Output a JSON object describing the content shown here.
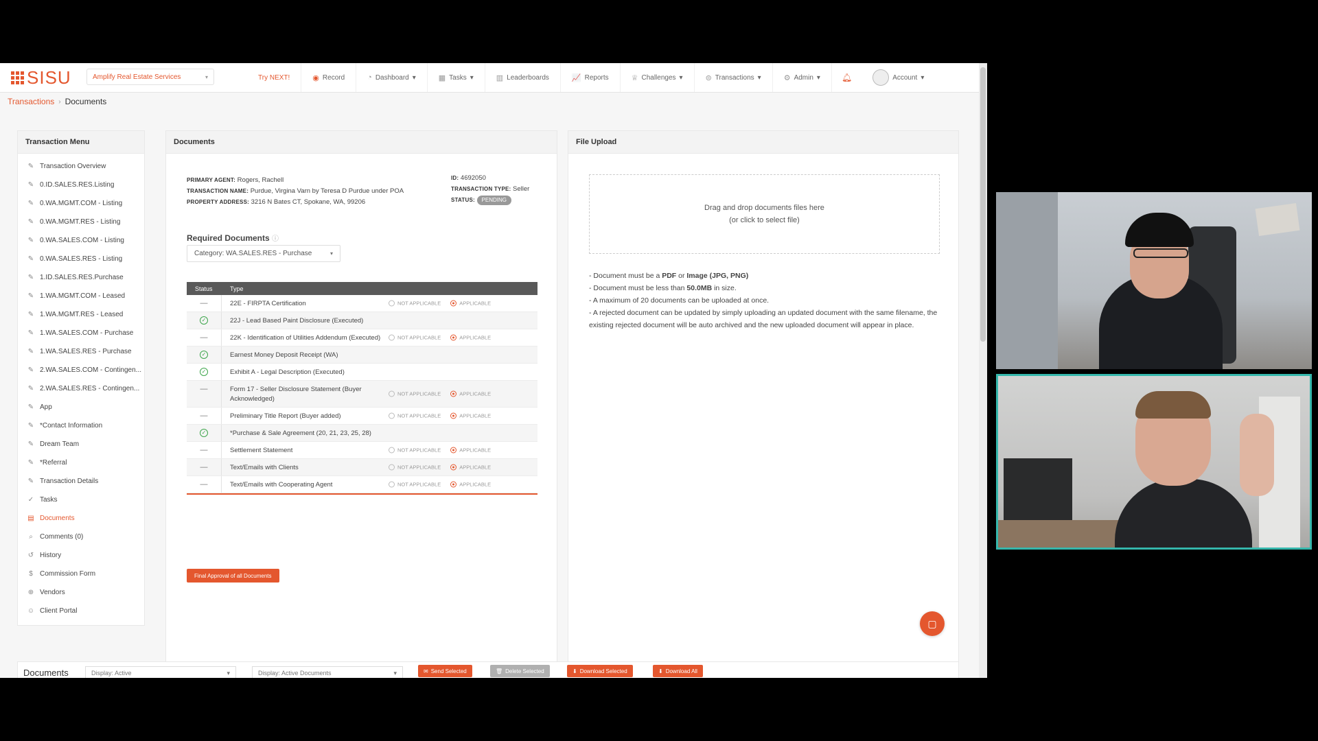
{
  "nav": {
    "logo_text": "SISU",
    "company": "Amplify Real Estate Services",
    "try_next": "Try NEXT!",
    "items": [
      {
        "label": "Record",
        "icon": "record-icon",
        "caret": ""
      },
      {
        "label": "Dashboard",
        "icon": "dashboard-icon",
        "caret": "▾"
      },
      {
        "label": "Tasks",
        "icon": "tasks-icon",
        "caret": "▾"
      },
      {
        "label": "Leaderboards",
        "icon": "leaderboards-icon",
        "caret": ""
      },
      {
        "label": "Reports",
        "icon": "reports-icon",
        "caret": ""
      },
      {
        "label": "Challenges",
        "icon": "trophy-icon",
        "caret": "▾"
      },
      {
        "label": "Transactions",
        "icon": "transactions-icon",
        "caret": "▾"
      },
      {
        "label": "Admin",
        "icon": "gear-icon",
        "caret": "▾"
      }
    ],
    "account": "Account"
  },
  "breadcrumb": {
    "parent": "Transactions",
    "current": "Documents"
  },
  "sidebar": {
    "title": "Transaction Menu",
    "items": [
      {
        "label": "Transaction Overview",
        "icon": "pencil-icon"
      },
      {
        "label": "0.ID.SALES.RES.Listing",
        "icon": "pencil-icon"
      },
      {
        "label": "0.WA.MGMT.COM - Listing",
        "icon": "pencil-icon"
      },
      {
        "label": "0.WA.MGMT.RES - Listing",
        "icon": "pencil-icon"
      },
      {
        "label": "0.WA.SALES.COM - Listing",
        "icon": "pencil-icon"
      },
      {
        "label": "0.WA.SALES.RES - Listing",
        "icon": "pencil-icon"
      },
      {
        "label": "1.ID.SALES.RES.Purchase",
        "icon": "pencil-icon"
      },
      {
        "label": "1.WA.MGMT.COM - Leased",
        "icon": "pencil-icon"
      },
      {
        "label": "1.WA.MGMT.RES - Leased",
        "icon": "pencil-icon"
      },
      {
        "label": "1.WA.SALES.COM - Purchase",
        "icon": "pencil-icon"
      },
      {
        "label": "1.WA.SALES.RES - Purchase",
        "icon": "pencil-icon"
      },
      {
        "label": "2.WA.SALES.COM - Contingen...",
        "icon": "pencil-icon"
      },
      {
        "label": "2.WA.SALES.RES - Contingen...",
        "icon": "pencil-icon"
      },
      {
        "label": "App",
        "icon": "pencil-icon"
      },
      {
        "label": "*Contact Information",
        "icon": "pencil-icon"
      },
      {
        "label": "Dream Team",
        "icon": "pencil-icon"
      },
      {
        "label": "*Referral",
        "icon": "pencil-icon"
      },
      {
        "label": "Transaction Details",
        "icon": "pencil-icon"
      },
      {
        "label": "Tasks",
        "icon": "check-circle-icon"
      },
      {
        "label": "Documents",
        "icon": "document-icon",
        "active": true
      },
      {
        "label": "Comments (0)",
        "icon": "comment-icon"
      },
      {
        "label": "History",
        "icon": "history-icon"
      },
      {
        "label": "Commission Form",
        "icon": "dollar-icon"
      },
      {
        "label": "Vendors",
        "icon": "globe-icon"
      },
      {
        "label": "Client Portal",
        "icon": "user-icon"
      }
    ]
  },
  "documents": {
    "title": "Documents",
    "primary_agent_label": "PRIMARY AGENT:",
    "primary_agent": "Rogers, Rachell",
    "transaction_name_label": "TRANSACTION NAME:",
    "transaction_name": "Purdue, Virgina Varn by Teresa D Purdue under POA",
    "property_address_label": "PROPERTY ADDRESS:",
    "property_address": "3216 N Bates CT, Spokane, WA, 99206",
    "id_label": "ID:",
    "id": "4692050",
    "transaction_type_label": "TRANSACTION TYPE:",
    "transaction_type": "Seller",
    "status_label": "STATUS:",
    "status": "PENDING",
    "required_title": "Required Documents",
    "category": "Category: WA.SALES.RES - Purchase",
    "col_status": "Status",
    "col_type": "Type",
    "opt_not_applicable": "NOT APPLICABLE",
    "opt_applicable": "APPLICABLE",
    "rows": [
      {
        "type": "22E - FIRPTA Certification",
        "status": "pending",
        "options": true
      },
      {
        "type": "22J - Lead Based Paint Disclosure (Executed)",
        "status": "done",
        "options": false
      },
      {
        "type": "22K - Identification of Utilities Addendum (Executed)",
        "status": "pending",
        "options": true
      },
      {
        "type": "Earnest Money Deposit Receipt (WA)",
        "status": "done",
        "options": false
      },
      {
        "type": "Exhibit A - Legal Description (Executed)",
        "status": "done",
        "options": false
      },
      {
        "type": "Form 17 - Seller Disclosure Statement (Buyer Acknowledged)",
        "status": "pending",
        "options": true
      },
      {
        "type": "Preliminary Title Report (Buyer added)",
        "status": "pending",
        "options": true
      },
      {
        "type": "*Purchase & Sale Agreement (20, 21, 23, 25, 28)",
        "status": "done",
        "options": false
      },
      {
        "type": "Settlement Statement",
        "status": "pending",
        "options": true
      },
      {
        "type": "Text/Emails with Clients",
        "status": "pending",
        "options": true
      },
      {
        "type": "Text/Emails with Cooperating Agent",
        "status": "pending",
        "options": true
      }
    ],
    "final_button": "Final Approval of all Documents"
  },
  "upload": {
    "title": "File Upload",
    "drop_line1": "Drag and drop documents files here",
    "drop_line2": "(or click to select file)",
    "rule1_pre": "- Document must be a ",
    "rule1_b1": "PDF",
    "rule1_mid": " or ",
    "rule1_b2": "Image (JPG, PNG)",
    "rule2_pre": "- Document must be less than ",
    "rule2_b": "50.0MB",
    "rule2_post": " in size.",
    "rule3": "- A maximum of 20 documents can be uploaded at once.",
    "rule4": "- A rejected document can be updated by simply uploading an updated document with the same filename, the existing rejected document will be auto archived and the new uploaded document will appear in place."
  },
  "bottom": {
    "title": "Documents",
    "display_active": "Display: Active",
    "display_docs": "Display: Active Documents",
    "send": "Send Selected",
    "delete": "Delete Selected",
    "download_selected": "Download Selected",
    "download_all": "Download All"
  },
  "colors": {
    "accent": "#e4572e",
    "success": "#3ca54a",
    "video_border": "#35b7ac"
  }
}
